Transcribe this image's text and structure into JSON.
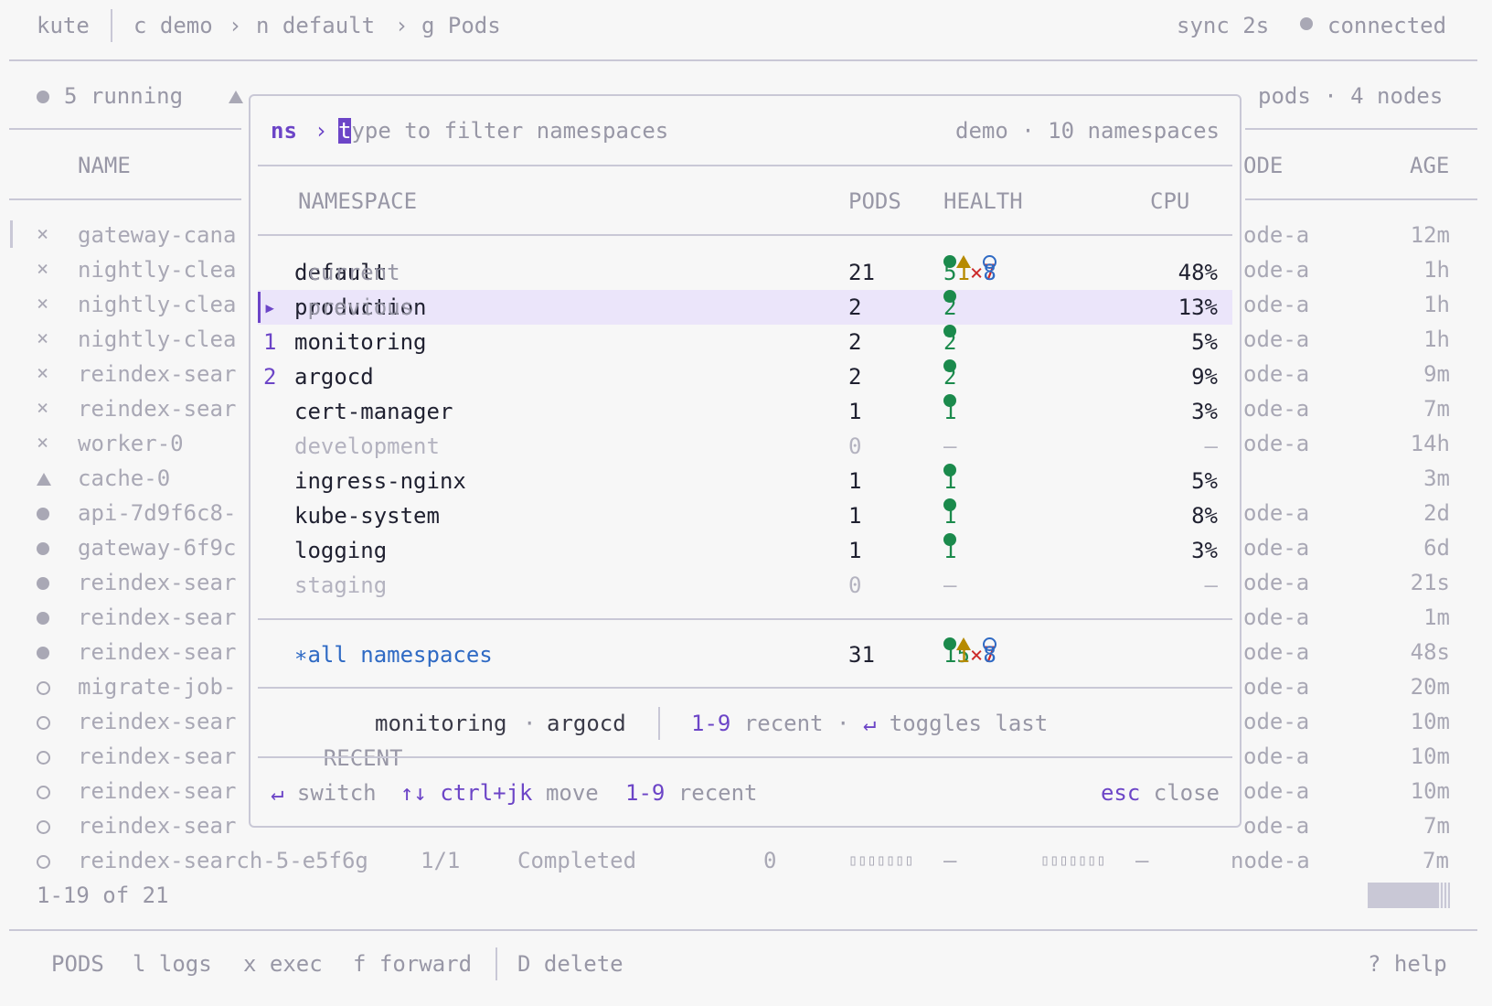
{
  "topbar": {
    "app": "kute",
    "crumbs": [
      {
        "key": "c",
        "value": "demo"
      },
      {
        "key": "n",
        "value": "default"
      },
      {
        "key": "g",
        "value": "Pods"
      }
    ],
    "crumb_sep": "›",
    "sync": "sync 2s",
    "status": "connected"
  },
  "summary": {
    "running": "5 running",
    "right": "pods · 4 nodes"
  },
  "pods_table": {
    "headers": {
      "name": "NAME",
      "node": "ODE",
      "age": "AGE"
    },
    "rows": [
      {
        "status": "x",
        "name": "gateway-cana",
        "node": "ode-a",
        "age": "12m"
      },
      {
        "status": "x",
        "name": "nightly-clea",
        "node": "ode-a",
        "age": "1h"
      },
      {
        "status": "x",
        "name": "nightly-clea",
        "node": "ode-a",
        "age": "1h"
      },
      {
        "status": "x",
        "name": "nightly-clea",
        "node": "ode-a",
        "age": "1h"
      },
      {
        "status": "x",
        "name": "reindex-sear",
        "node": "ode-a",
        "age": "9m"
      },
      {
        "status": "x",
        "name": "reindex-sear",
        "node": "ode-a",
        "age": "7m"
      },
      {
        "status": "x",
        "name": "worker-0",
        "node": "ode-a",
        "age": "14h"
      },
      {
        "status": "warn",
        "name": "cache-0",
        "node": "",
        "age": "3m"
      },
      {
        "status": "dot",
        "name": "api-7d9f6c8-",
        "node": "ode-a",
        "age": "2d"
      },
      {
        "status": "dot",
        "name": "gateway-6f9c",
        "node": "ode-a",
        "age": "6d"
      },
      {
        "status": "dot",
        "name": "reindex-sear",
        "node": "ode-a",
        "age": "21s"
      },
      {
        "status": "dot",
        "name": "reindex-sear",
        "node": "ode-a",
        "age": "1m"
      },
      {
        "status": "dot",
        "name": "reindex-sear",
        "node": "ode-a",
        "age": "48s"
      },
      {
        "status": "ring",
        "name": "migrate-job-",
        "node": "ode-a",
        "age": "20m"
      },
      {
        "status": "ring",
        "name": "reindex-sear",
        "node": "ode-a",
        "age": "10m"
      },
      {
        "status": "ring",
        "name": "reindex-sear",
        "node": "ode-a",
        "age": "10m"
      },
      {
        "status": "ring",
        "name": "reindex-sear",
        "node": "ode-a",
        "age": "10m"
      },
      {
        "status": "ring",
        "name": "reindex-sear",
        "node": "ode-a",
        "age": "7m"
      }
    ],
    "last_row": {
      "status": "ring",
      "name": "reindex-search-5-e5f6g",
      "ready": "1/1",
      "state": "Completed",
      "restarts": "0",
      "cpu_bar": "▯▯▯▯▯▯▯",
      "cpu": "–",
      "mem_bar": "▯▯▯▯▯▯▯",
      "mem": "–",
      "node": "node-a",
      "age": "7m"
    },
    "pagination": "1-19 of 21"
  },
  "footer": {
    "mode": "PODS",
    "actions": [
      {
        "key": "l",
        "label": "logs"
      },
      {
        "key": "x",
        "label": "exec"
      },
      {
        "key": "f",
        "label": "forward"
      },
      {
        "key": "D",
        "label": "delete"
      }
    ],
    "help_key": "?",
    "help_label": "help"
  },
  "modal": {
    "prompt": "ns",
    "prompt_sep": "›",
    "placeholder_first": "t",
    "placeholder_rest": "ype to filter namespaces",
    "context": "demo · 10 namespaces",
    "headers": {
      "namespace": "NAMESPACE",
      "pods": "PODS",
      "health": "HEALTH",
      "cpu": "CPU"
    },
    "rows": [
      {
        "marker": "",
        "name": "default",
        "tag": "current",
        "pods": "21",
        "health": {
          "ok": "5",
          "warn": "1",
          "fail": "7",
          "done": "8"
        },
        "cpu": "48%"
      },
      {
        "marker": "▸",
        "name": "production",
        "tag": "previous",
        "pods": "2",
        "health": {
          "ok": "2"
        },
        "cpu": "13%",
        "selected": true
      },
      {
        "marker": "1",
        "name": "monitoring",
        "tag": "",
        "pods": "2",
        "health": {
          "ok": "2"
        },
        "cpu": "5%"
      },
      {
        "marker": "2",
        "name": "argocd",
        "tag": "",
        "pods": "2",
        "health": {
          "ok": "2"
        },
        "cpu": "9%"
      },
      {
        "marker": "",
        "name": "cert-manager",
        "tag": "",
        "pods": "1",
        "health": {
          "ok": "1"
        },
        "cpu": "3%"
      },
      {
        "marker": "",
        "name": "development",
        "tag": "",
        "pods": "0",
        "health_empty": "–",
        "cpu": "–",
        "faded": true
      },
      {
        "marker": "",
        "name": "ingress-nginx",
        "tag": "",
        "pods": "1",
        "health": {
          "ok": "1"
        },
        "cpu": "5%"
      },
      {
        "marker": "",
        "name": "kube-system",
        "tag": "",
        "pods": "1",
        "health": {
          "ok": "1"
        },
        "cpu": "8%"
      },
      {
        "marker": "",
        "name": "logging",
        "tag": "",
        "pods": "1",
        "health": {
          "ok": "1"
        },
        "cpu": "3%"
      },
      {
        "marker": "",
        "name": "staging",
        "tag": "",
        "pods": "0",
        "health_empty": "–",
        "cpu": "–",
        "faded": true
      }
    ],
    "all_row": {
      "icon": "∗",
      "label": "all namespaces",
      "pods": "31",
      "health": {
        "ok": "15",
        "warn": "1",
        "fail": "7",
        "done": "8"
      }
    },
    "recent": {
      "label": "RECENT",
      "items": [
        "monitoring",
        "argocd"
      ],
      "sep": "·",
      "hint_key": "1-9",
      "hint_label": "recent",
      "hint_enter": "↵",
      "hint_enter_label": "toggles last"
    },
    "keys": [
      {
        "key": "↵",
        "label": "switch"
      },
      {
        "key": "↑↓ ctrl+jk",
        "label": "move"
      },
      {
        "key": "1-9",
        "label": "recent"
      }
    ],
    "close_key": "esc",
    "close_label": "close"
  },
  "colors": {
    "accent": "#6c45c7",
    "ok": "#1b8a4c",
    "warn": "#b68a00",
    "fail": "#cc2b2b",
    "info": "#2f6ac4"
  }
}
